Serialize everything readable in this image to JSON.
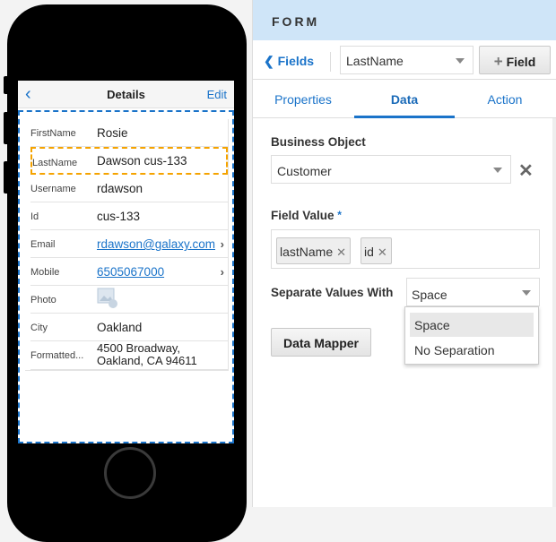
{
  "phone": {
    "header": {
      "back_icon": "chevron-left-icon",
      "title": "Details",
      "edit_label": "Edit"
    },
    "rows": [
      {
        "label": "FirstName",
        "value": "Rosie"
      },
      {
        "label": "LastName",
        "value": "Dawson cus-133"
      },
      {
        "label": "Username",
        "value": "rdawson"
      },
      {
        "label": "Id",
        "value": "cus-133"
      },
      {
        "label": "Email",
        "value": "rdawson@galaxy.com"
      },
      {
        "label": "Mobile",
        "value": "6505067000"
      },
      {
        "label": "Photo",
        "value": ""
      },
      {
        "label": "City",
        "value": "Oakland"
      },
      {
        "label": "Formatted...",
        "value": "4500 Broadway,",
        "value2": "Oakland, CA 94611"
      }
    ]
  },
  "panel": {
    "title": "FORM",
    "fields_link": "Fields",
    "field_select": "LastName",
    "add_field_label": "Field",
    "tabs": [
      "Properties",
      "Data",
      "Action"
    ],
    "active_tab": "Data",
    "business_object_label": "Business Object",
    "business_object_value": "Customer",
    "field_value_label": "Field Value",
    "required_mark": "*",
    "chips": [
      "lastName",
      "id"
    ],
    "separate_label": "Separate Values With",
    "separate_value": "Space",
    "separate_options": [
      "Space",
      "No Separation"
    ],
    "data_mapper_label": "Data Mapper"
  },
  "colors": {
    "accent": "#1a73c9",
    "selection": "#f5a300",
    "header_bg": "#cfe5f8"
  }
}
